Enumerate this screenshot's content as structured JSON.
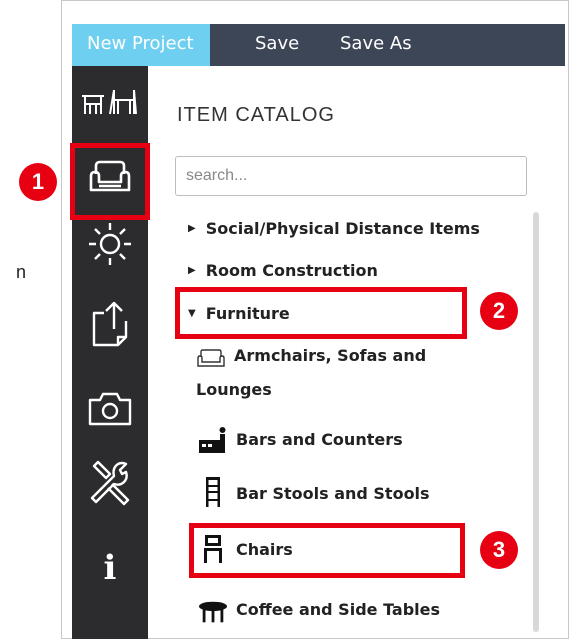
{
  "toolbar": {
    "tabs": [
      {
        "label": "New Project"
      },
      {
        "label": "Save"
      },
      {
        "label": "Save As"
      }
    ]
  },
  "rail": {
    "icons": [
      "floorplan-icon",
      "armchair-icon",
      "light-icon",
      "export-icon",
      "camera-icon",
      "tools-icon",
      "info-icon"
    ],
    "info_glyph": "i"
  },
  "catalog": {
    "title": "ITEM CATALOG",
    "search_placeholder": "search...",
    "categories": [
      {
        "label": "Social/Physical Distance Items",
        "expanded": false
      },
      {
        "label": "Room Construction",
        "expanded": false
      },
      {
        "label": "Furniture",
        "expanded": true
      }
    ],
    "furniture_items": [
      {
        "line1": "Armchairs, Sofas and",
        "line2": "Lounges",
        "icon": "sofa-icon"
      },
      {
        "label": "Bars and Counters",
        "icon": "bar-counter-icon"
      },
      {
        "label": "Bar Stools and Stools",
        "icon": "bar-stool-icon"
      },
      {
        "label": "Chairs",
        "icon": "chair-icon"
      },
      {
        "label": "Coffee and Side Tables",
        "icon": "table-icon"
      }
    ]
  },
  "annotations": {
    "badges": [
      "1",
      "2",
      "3"
    ],
    "highlight_color": "#e60012",
    "edge_text": "n"
  },
  "colors": {
    "topbar": "#3d4657",
    "active_tab": "#6ecff0",
    "rail": "#2c2c2e"
  }
}
